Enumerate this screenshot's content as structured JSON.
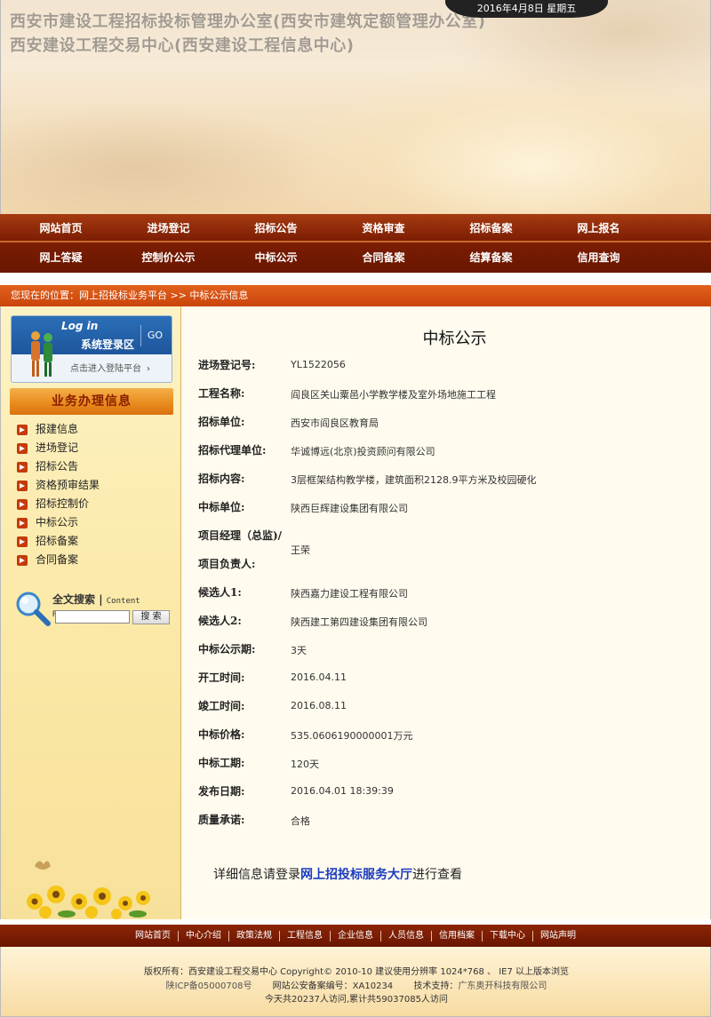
{
  "banner": {
    "title_line1": "西安市建设工程招标投标管理办公室(西安市建筑定额管理办公室)",
    "title_line2": "西安建设工程交易中心(西安建设工程信息中心)",
    "date": "2016年4月8日 星期五"
  },
  "nav": {
    "row1": [
      "网站首页",
      "进场登记",
      "招标公告",
      "资格审查",
      "招标备案",
      "网上报名"
    ],
    "row2": [
      "网上答疑",
      "控制价公示",
      "中标公示",
      "合同备案",
      "结算备案",
      "信用查询"
    ]
  },
  "breadcrumb": "您现在的位置：网上招投标业务平台 >> 中标公示信息",
  "sidebar": {
    "login_en": "Log in",
    "login_cn": "系统登录区",
    "login_go": "GO",
    "login_enter": "点击进入登陆平台",
    "biz_title": "业务办理信息",
    "biz_items": [
      "报建信息",
      "进场登记",
      "招标公告",
      "资格预审结果",
      "招标控制价",
      "中标公示",
      "招标备案",
      "合同备案"
    ],
    "search_title": "全文搜索",
    "search_title_en": "Content Retrieval",
    "search_button": "搜 索",
    "search_value": ""
  },
  "main": {
    "title": "中标公示",
    "fields": [
      {
        "label": "进场登记号:",
        "value": "YL1522056"
      },
      {
        "label": "工程名称:",
        "value": "阎良区关山粟邑小学教学楼及室外场地施工工程"
      },
      {
        "label": "招标单位:",
        "value": "西安市阎良区教育局"
      },
      {
        "label": "招标代理单位:",
        "value": "华诚博远(北京)投资顾问有限公司"
      },
      {
        "label": "招标内容:",
        "value": "3层框架结构教学楼，建筑面积2128.9平方米及校园硬化"
      },
      {
        "label": "中标单位:",
        "value": "陕西巨辉建设集团有限公司"
      },
      {
        "label": "项目经理（总监)/",
        "label2": "项目负责人:",
        "value": "王荣"
      },
      {
        "label": "候选人1:",
        "value": "陕西嘉力建设工程有限公司"
      },
      {
        "label": "候选人2:",
        "value": "陕西建工第四建设集团有限公司"
      },
      {
        "label": "中标公示期:",
        "value": "3天"
      },
      {
        "label": "开工时间:",
        "value": "2016.04.11"
      },
      {
        "label": "竣工时间:",
        "value": "2016.08.11"
      },
      {
        "label": "中标价格:",
        "value": "535.0606190000001万元"
      },
      {
        "label": "中标工期:",
        "value": "120天"
      },
      {
        "label": "发布日期:",
        "value": "2016.04.01 18:39:39"
      },
      {
        "label": "质量承诺:",
        "value": "合格"
      }
    ],
    "detail_prefix": "详细信息请登录",
    "detail_link": "网上招投标服务大厅",
    "detail_suffix": "进行查看"
  },
  "footer": {
    "links": [
      "网站首页",
      "中心介绍",
      "政策法规",
      "工程信息",
      "企业信息",
      "人员信息",
      "信用档案",
      "下载中心",
      "网站声明"
    ],
    "copyright": "版权所有：西安建设工程交易中心 Copyright© 2010-10 建议使用分辨率 1024*768 、 IE7 以上版本浏览",
    "icp": "陕ICP备05000708号",
    "police": "网站公安备案编号：XA10234",
    "support_label": "技术支持：",
    "support": "广东奥开科技有限公司",
    "visits": "今天共20237人访问,累计共59037085人访问"
  }
}
